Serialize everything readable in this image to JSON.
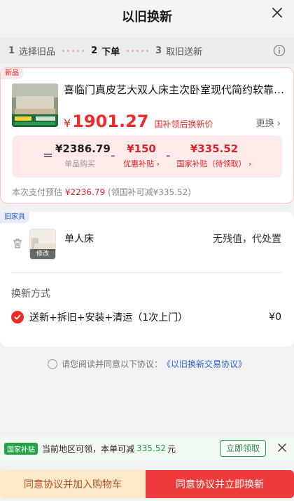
{
  "header": {
    "title": "以旧换新",
    "close_icon": "close-icon"
  },
  "steps": [
    {
      "num": "1",
      "label": "选择旧品"
    },
    {
      "num": "2",
      "label": "下单"
    },
    {
      "num": "3",
      "label": "取旧送新"
    }
  ],
  "new_item": {
    "tag": "新品",
    "title": "喜临门真皮艺大双人床主次卧室现代简约软靠包...",
    "price_currency": "¥",
    "price": "1901.27",
    "price_note": "国补领后换新价",
    "swap_label": "更换",
    "breakdown": {
      "eq": "=",
      "item1_amount": "¥2386.79",
      "item1_label": "单品购买",
      "minus1": "-",
      "item2_amount": "¥150",
      "item2_label": "优惠补贴",
      "minus2": "-",
      "item3_amount": "¥335.52",
      "item3_label": "国家补贴（待领取）"
    },
    "pay_prefix": "本次支付预估",
    "pay_amount": "¥2236.79",
    "pay_suffix": "(领国补可减¥335.52)"
  },
  "old_item": {
    "tag": "旧家具",
    "modify_label": "修改",
    "name": "单人床",
    "value_text": "无残值，代处置",
    "method_title": "换新方式",
    "method_text": "送新+拆旧+安装+清运（1次上门）",
    "method_price": "¥0"
  },
  "agreement": {
    "prefix": "请您阅读并同意以下协议：",
    "link": "《以旧换新交易协议》"
  },
  "subsidy_bar": {
    "badge": "国家补贴",
    "text_prefix": "当前地区可领，本单可减",
    "amount": "335.52",
    "unit": "元",
    "claim_label": "立即领取"
  },
  "bottom": {
    "cart_label": "同意协议并加入购物车",
    "now_label": "同意协议并立即换新"
  },
  "colors": {
    "brand_red": "#ee2a2a",
    "subsidy_green": "#24a047",
    "link_blue": "#2f64d8"
  }
}
